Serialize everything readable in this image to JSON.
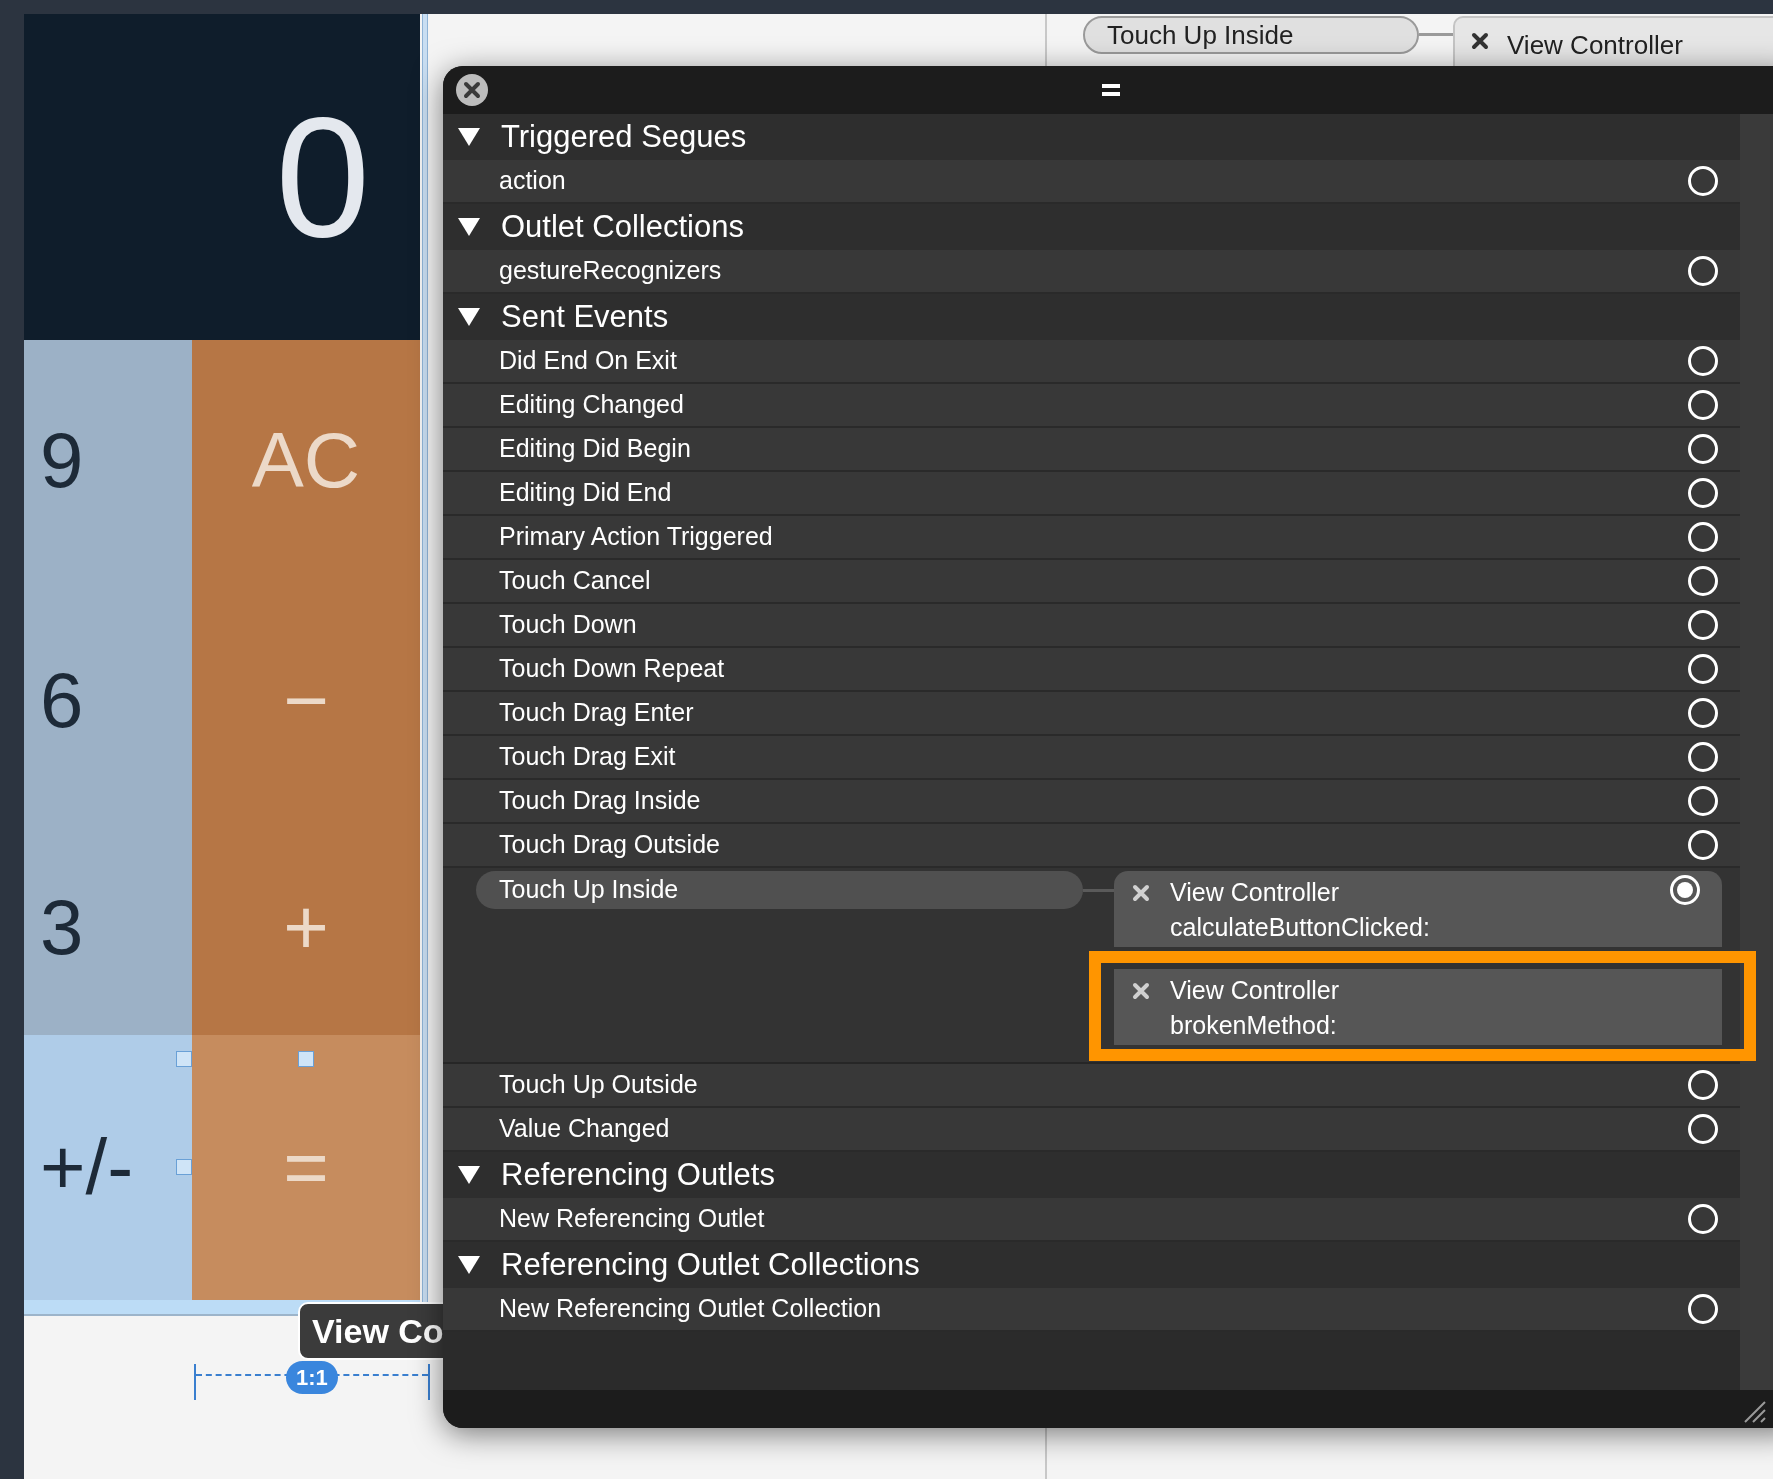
{
  "calculator": {
    "display": "0",
    "keys": [
      {
        "label": "9",
        "kind": "number",
        "selected": false
      },
      {
        "label": "AC",
        "kind": "operator",
        "selected": false
      },
      {
        "label": "6",
        "kind": "number",
        "selected": false
      },
      {
        "label": "−",
        "kind": "operator",
        "selected": false
      },
      {
        "label": "3",
        "kind": "number",
        "selected": false
      },
      {
        "label": "+",
        "kind": "operator",
        "selected": false
      },
      {
        "label": "+/-",
        "kind": "number",
        "selected": true
      },
      {
        "label": "=",
        "kind": "operator",
        "selected": true
      }
    ]
  },
  "canvas_label": "View Co",
  "ratio_badge": "1:1",
  "background_connection": {
    "event": "Touch Up Inside",
    "target": "View Controller"
  },
  "panel": {
    "sections": [
      {
        "title": "Triggered Segues",
        "expanded": true,
        "items": [
          {
            "label": "action",
            "connected": false
          }
        ]
      },
      {
        "title": "Outlet Collections",
        "expanded": true,
        "items": [
          {
            "label": "gestureRecognizers",
            "connected": false
          }
        ]
      },
      {
        "title": "Sent Events",
        "expanded": true,
        "items": [
          {
            "label": "Did End On Exit",
            "connected": false
          },
          {
            "label": "Editing Changed",
            "connected": false
          },
          {
            "label": "Editing Did Begin",
            "connected": false
          },
          {
            "label": "Editing Did End",
            "connected": false
          },
          {
            "label": "Primary Action Triggered",
            "connected": false
          },
          {
            "label": "Touch Cancel",
            "connected": false
          },
          {
            "label": "Touch Down",
            "connected": false
          },
          {
            "label": "Touch Down Repeat",
            "connected": false
          },
          {
            "label": "Touch Drag Enter",
            "connected": false
          },
          {
            "label": "Touch Drag Exit",
            "connected": false
          },
          {
            "label": "Touch Drag Inside",
            "connected": false
          },
          {
            "label": "Touch Drag Outside",
            "connected": false
          },
          {
            "label": "Touch Up Inside",
            "connected": true,
            "connections": [
              {
                "target": "View Controller",
                "method": "calculateButtonClicked:",
                "highlighted": false
              },
              {
                "target": "View Controller",
                "method": "brokenMethod:",
                "highlighted": true
              }
            ]
          },
          {
            "label": "Touch Up Outside",
            "connected": false
          },
          {
            "label": "Value Changed",
            "connected": false
          }
        ]
      },
      {
        "title": "Referencing Outlets",
        "expanded": true,
        "items": [
          {
            "label": "New Referencing Outlet",
            "connected": false
          }
        ]
      },
      {
        "title": "Referencing Outlet Collections",
        "expanded": true,
        "items": [
          {
            "label": "New Referencing Outlet Collection",
            "connected": false
          }
        ]
      }
    ]
  }
}
